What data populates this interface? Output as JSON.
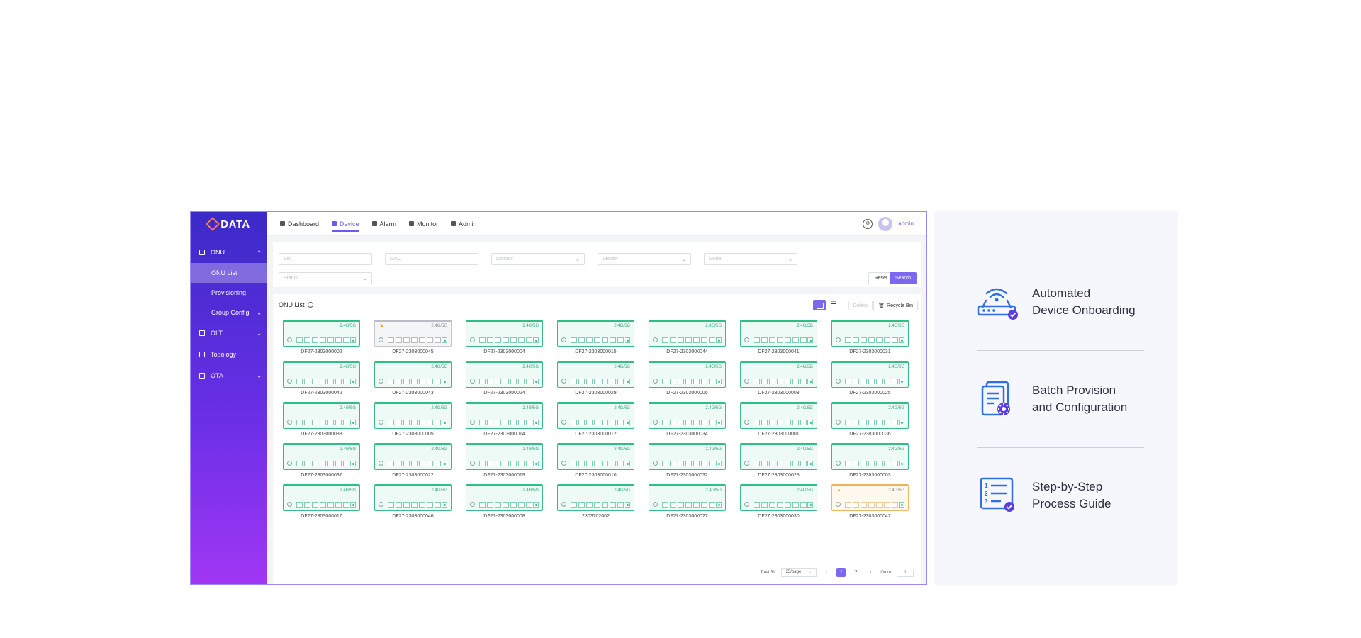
{
  "sidebar": {
    "logo": "DATA",
    "items": [
      {
        "label": "ONU",
        "expanded": true
      },
      {
        "label": "ONU List",
        "active": true
      },
      {
        "label": "Provisioning"
      },
      {
        "label": "Group Config"
      },
      {
        "label": "OLT"
      },
      {
        "label": "Topology"
      },
      {
        "label": "OTA"
      }
    ]
  },
  "topbar": {
    "tabs": [
      "Dashboard",
      "Device",
      "Alarm",
      "Monitor",
      "Admin"
    ],
    "active_tab": "Device",
    "user": "admin"
  },
  "filters": {
    "sn": "SN",
    "mac": "MAC",
    "domain": "Domain",
    "vendor": "Vendor",
    "model": "Model",
    "status": "Status",
    "reset_label": "Reset",
    "search_label": "Search"
  },
  "list": {
    "title": "ONU List",
    "delete_label": "Delete",
    "recycle_label": "Recycle Bin",
    "band_label": "2.4G/5G",
    "devices": [
      {
        "sn": "DF27-2303000002",
        "state": "online"
      },
      {
        "sn": "DF27-2303000045",
        "state": "offline"
      },
      {
        "sn": "DF27-2303000004",
        "state": "online"
      },
      {
        "sn": "DF27-2303000015",
        "state": "online"
      },
      {
        "sn": "DF27-2303000044",
        "state": "online"
      },
      {
        "sn": "DF27-2303000041",
        "state": "online"
      },
      {
        "sn": "DF27-2303000031",
        "state": "online"
      },
      {
        "sn": "DF27-2303000042",
        "state": "online"
      },
      {
        "sn": "DF27-2303000043",
        "state": "online"
      },
      {
        "sn": "DF27-2303000024",
        "state": "online"
      },
      {
        "sn": "DF27-2303000029",
        "state": "online"
      },
      {
        "sn": "DF27-2303000006",
        "state": "online"
      },
      {
        "sn": "DF27-2303000003",
        "state": "online"
      },
      {
        "sn": "DF27-2303000025",
        "state": "online"
      },
      {
        "sn": "DF27-2303000033",
        "state": "online"
      },
      {
        "sn": "DF27-2303000005",
        "state": "online"
      },
      {
        "sn": "DF27-2303000014",
        "state": "online"
      },
      {
        "sn": "DF27-2303000012",
        "state": "online"
      },
      {
        "sn": "DF27-2303000034",
        "state": "online"
      },
      {
        "sn": "DF27-2303000001",
        "state": "online"
      },
      {
        "sn": "DF27-2303000036",
        "state": "online"
      },
      {
        "sn": "DF27-2303000037",
        "state": "online"
      },
      {
        "sn": "DF27-2303000022",
        "state": "online"
      },
      {
        "sn": "DF27-2303000019",
        "state": "online"
      },
      {
        "sn": "DF27-2303000010",
        "state": "online"
      },
      {
        "sn": "DF27-2303000032",
        "state": "online"
      },
      {
        "sn": "DF27-2303000028",
        "state": "online"
      },
      {
        "sn": "DF27-2303000003",
        "state": "online"
      },
      {
        "sn": "DF27-2303000017",
        "state": "online"
      },
      {
        "sn": "DF27-2303000046",
        "state": "online"
      },
      {
        "sn": "DF27-2303000008",
        "state": "online"
      },
      {
        "sn": "2303702002",
        "state": "online"
      },
      {
        "sn": "DF27-2303000027",
        "state": "online"
      },
      {
        "sn": "DF27-2303000030",
        "state": "online"
      },
      {
        "sn": "DF27-2303000047",
        "state": "warning"
      }
    ]
  },
  "pagination": {
    "total": "Total 51",
    "page_size": "35/page",
    "pages": [
      "1",
      "2"
    ],
    "current": "1",
    "goto_label": "Go to",
    "goto_value": "1"
  },
  "features": [
    {
      "line1": "Automated",
      "line2": "Device Onboarding",
      "icon": "router-icon"
    },
    {
      "line1": "Batch Provision",
      "line2": "and Configuration",
      "icon": "batch-config-icon"
    },
    {
      "line1": "Step-by-Step",
      "line2": "Process Guide",
      "icon": "checklist-icon"
    }
  ],
  "colors": {
    "accent": "#7b68ee",
    "online": "#2fbf86",
    "offline": "#b8bcc4",
    "warning": "#f2b05a",
    "feature_icon": "#2f6fe0"
  }
}
